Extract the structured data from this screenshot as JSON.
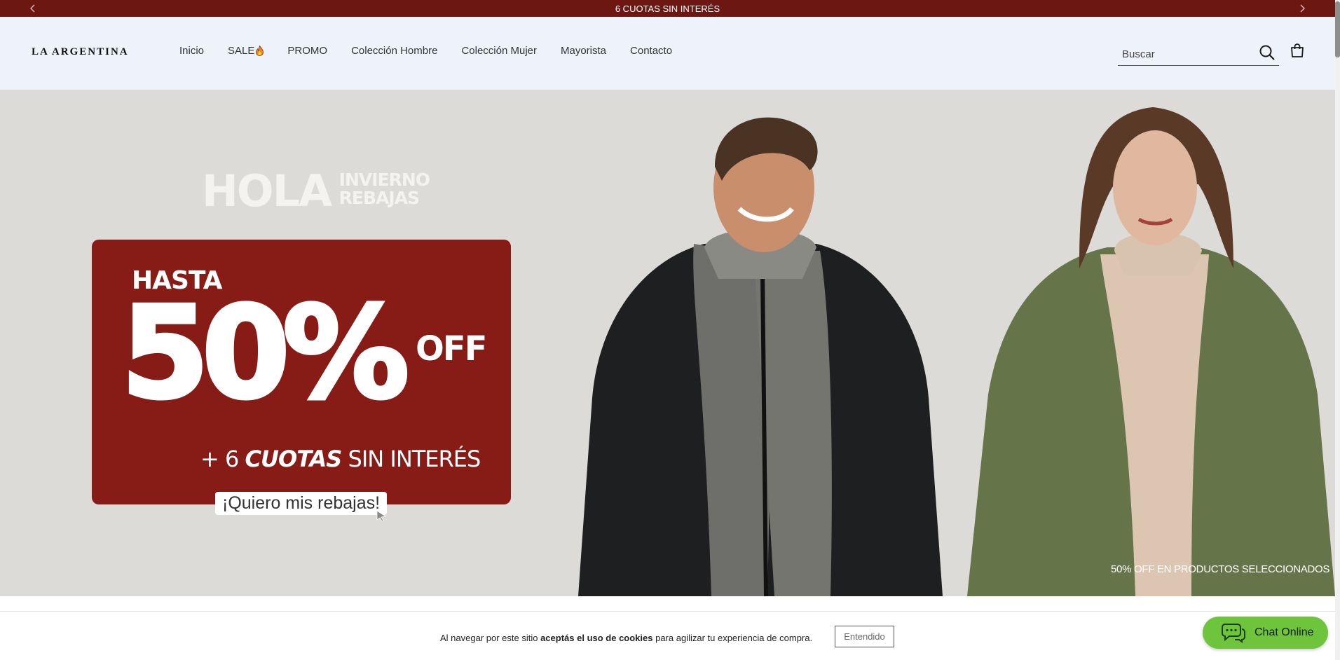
{
  "announcement": {
    "text": "6 CUOTAS SIN INTERÉS",
    "prev_icon": "chevron-left-icon",
    "next_icon": "chevron-right-icon"
  },
  "header": {
    "logo": "LA ARGENTINA",
    "nav": [
      {
        "label": "Inicio"
      },
      {
        "label": "SALE",
        "icon": "flame-icon"
      },
      {
        "label": "PROMO"
      },
      {
        "label": "Colección Hombre"
      },
      {
        "label": "Colección Mujer"
      },
      {
        "label": "Mayorista"
      },
      {
        "label": "Contacto"
      }
    ],
    "search": {
      "placeholder": "Buscar",
      "icon": "search-icon"
    },
    "cart_icon": "shopping-bag-icon"
  },
  "hero": {
    "hola": "HOLA",
    "hola_sub_1": "INVIERNO",
    "hola_sub_2": "REBAJAS",
    "hasta": "HASTA",
    "percent": "50%",
    "off": "OFF",
    "cuotas_prefix": "+ 6 ",
    "cuotas_bold": "CUOTAS",
    "cuotas_suffix": " SIN INTERÉS",
    "cta": "¡Quiero mis rebajas!",
    "disclaimer": "50% OFF EN PRODUCTOS SELECCIONADOS",
    "colors": {
      "promo_red": "#871b16",
      "background": "#dcdbd7"
    }
  },
  "cookie_bar": {
    "text_before": "Al navegar por este sitio ",
    "text_bold": "aceptás el uso de cookies",
    "text_after": " para agilizar tu experiencia de compra.",
    "button": "Entendido"
  },
  "chat": {
    "label": "Chat Online",
    "icon": "chat-bubbles-icon",
    "color": "#6ec43a"
  },
  "colors": {
    "announcement_bar": "#6d1712",
    "header_bg": "#eef2fb"
  }
}
